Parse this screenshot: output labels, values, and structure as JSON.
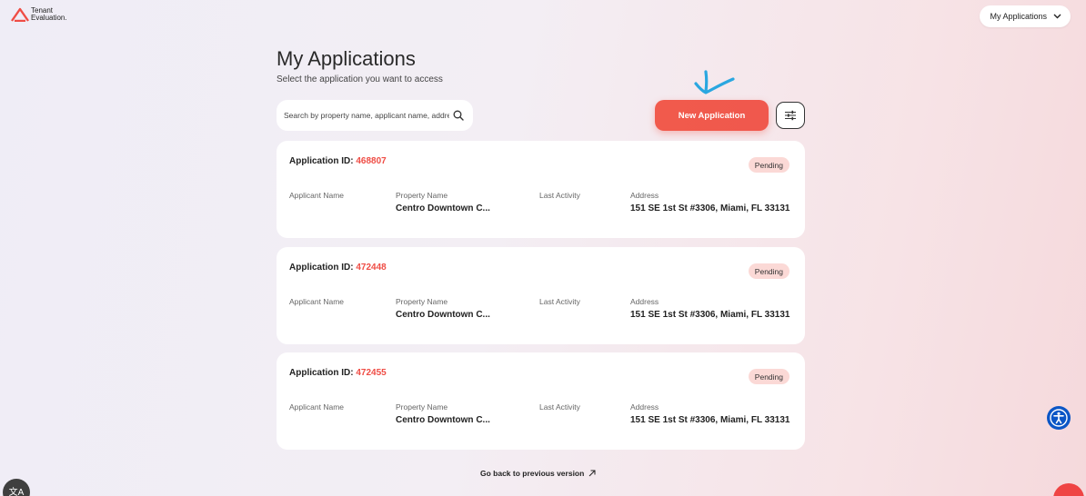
{
  "brand": {
    "logo_line1": "Tenant",
    "logo_line2": "Evaluation.",
    "accent": "#ef4d45"
  },
  "top_menu": {
    "label": "My Applications"
  },
  "page": {
    "title": "My Applications",
    "subtitle": "Select the application you want to access"
  },
  "search": {
    "placeholder": "Search by property name, applicant name, address"
  },
  "actions": {
    "new_application_label": "New Application"
  },
  "field_labels": {
    "applicant_name": "Applicant Name",
    "property_name": "Property Name",
    "last_activity": "Last Activity",
    "address": "Address"
  },
  "applications": [
    {
      "id_label": "Application ID:",
      "id": "468807",
      "status": "Pending",
      "applicant_name": "",
      "property_name": "Centro Downtown C...",
      "last_activity": "",
      "address": "151 SE 1st St #3306, Miami, FL 33131"
    },
    {
      "id_label": "Application ID:",
      "id": "472448",
      "status": "Pending",
      "applicant_name": "",
      "property_name": "Centro Downtown C...",
      "last_activity": "",
      "address": "151 SE 1st St #3306, Miami, FL 33131"
    },
    {
      "id_label": "Application ID:",
      "id": "472455",
      "status": "Pending",
      "applicant_name": "",
      "property_name": "Centro Downtown C...",
      "last_activity": "",
      "address": "151 SE 1st St #3306, Miami, FL 33131"
    }
  ],
  "footer": {
    "go_back_label": "Go back to previous version"
  },
  "icons": {
    "search": "search-icon",
    "filter": "sliders-icon",
    "chevron": "chevron-down-icon",
    "external": "arrow-up-right-icon",
    "accessibility": "accessibility-icon",
    "translate": "translate-icon"
  }
}
